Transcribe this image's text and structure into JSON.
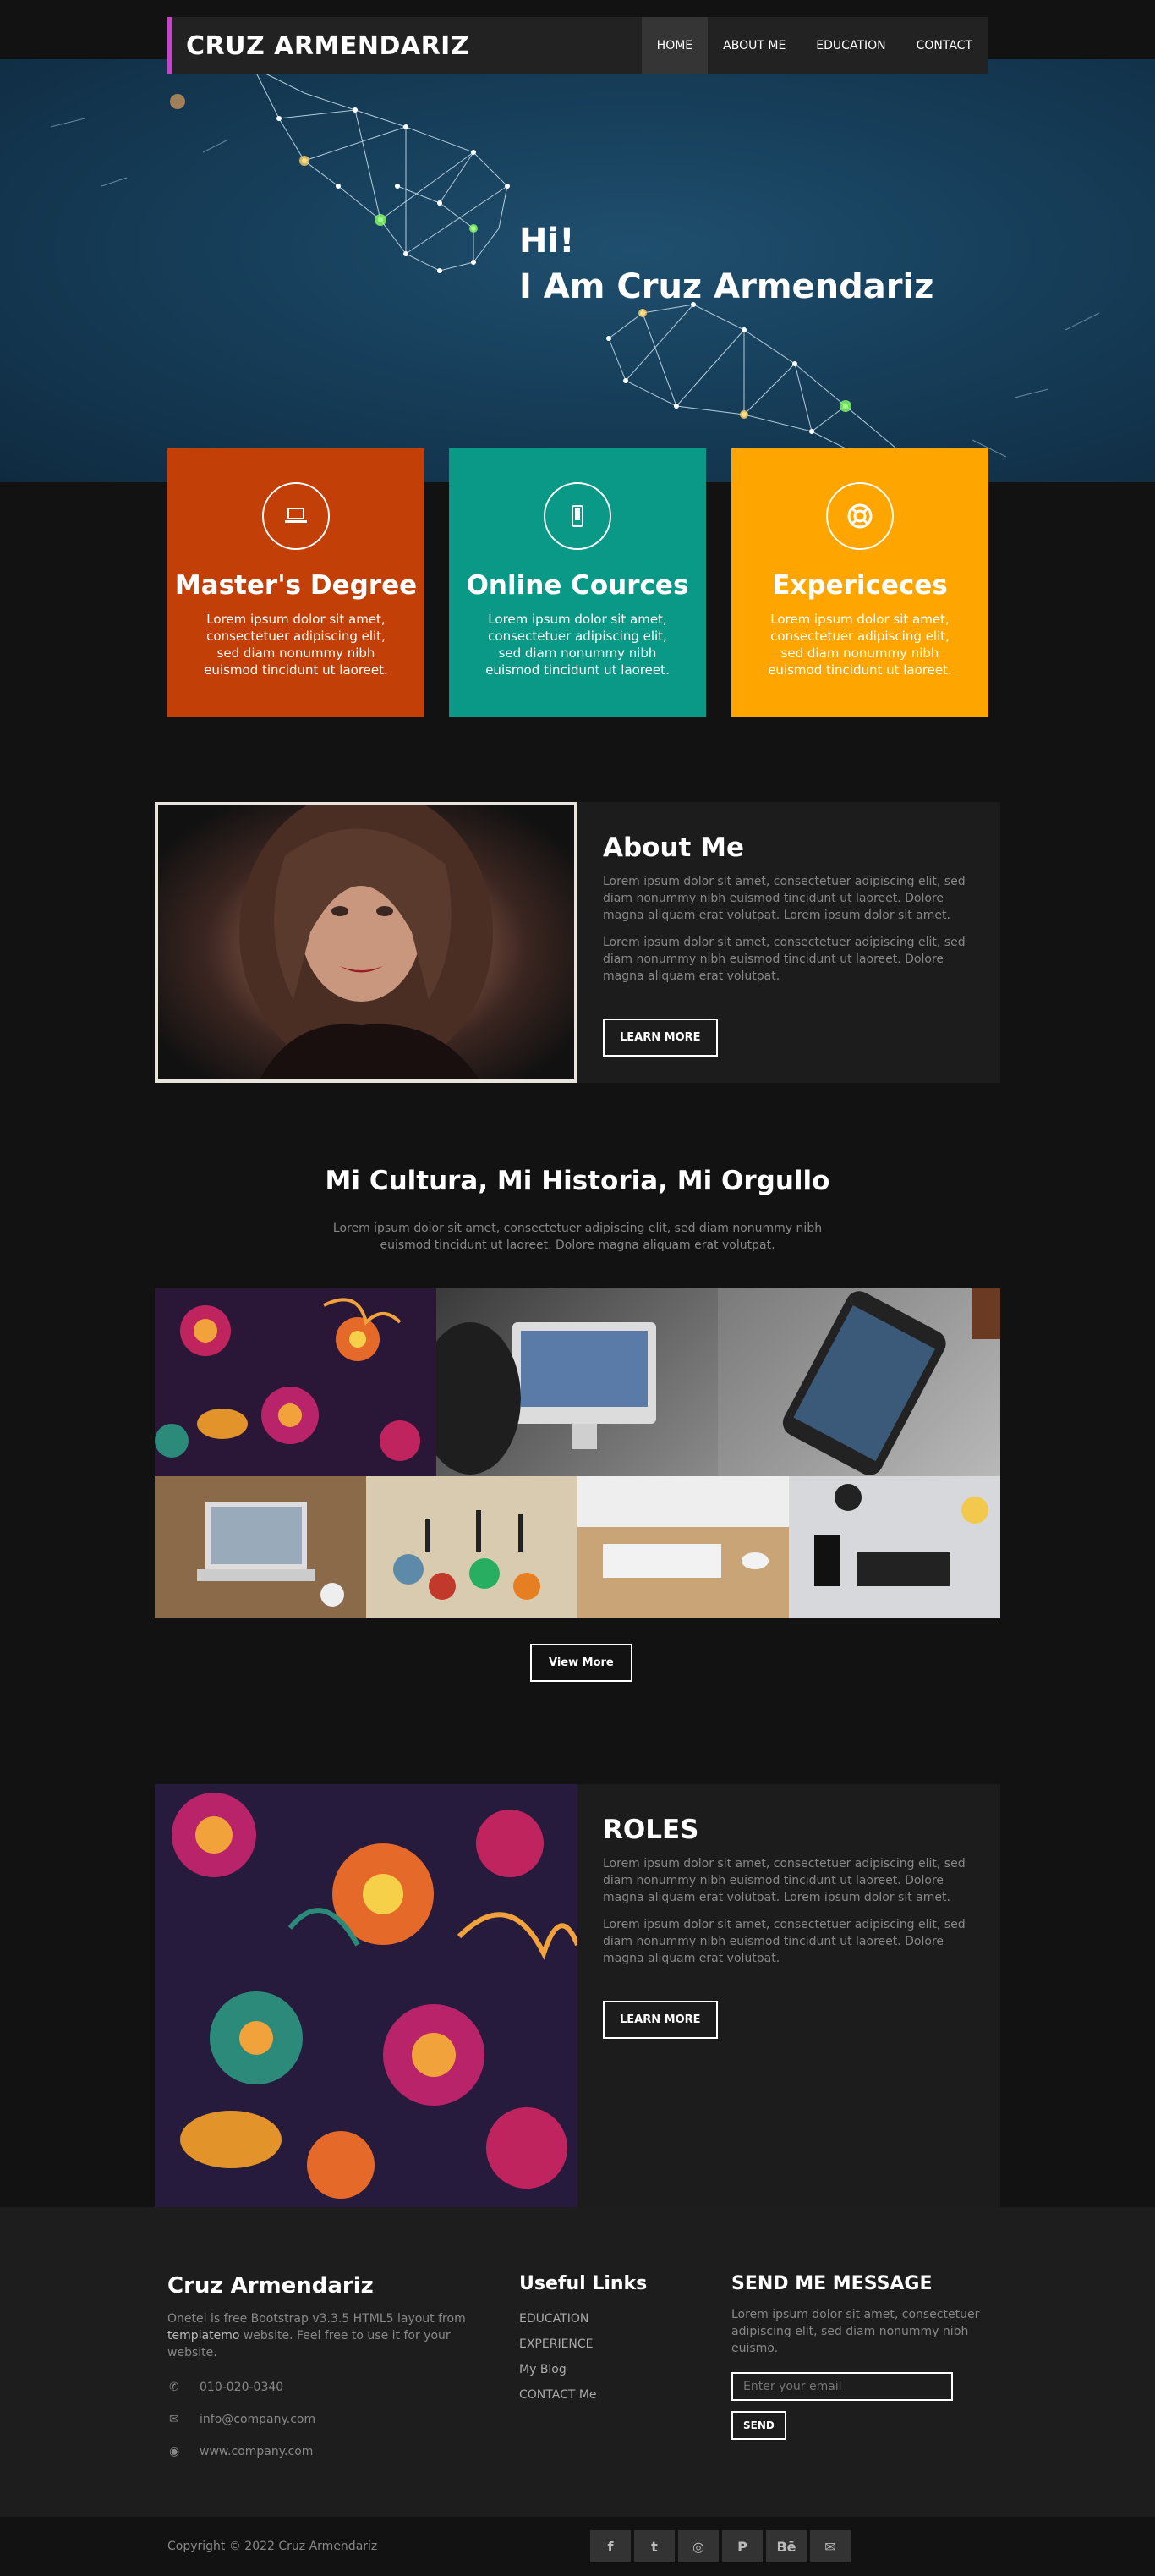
{
  "nav": {
    "brand": "CRUZ ARMENDARIZ",
    "accent": "#c146c8",
    "links": [
      "HOME",
      "ABOUT ME",
      "EDUCATION",
      "CONTACT"
    ],
    "active": "HOME"
  },
  "hero": {
    "line1": "Hi!",
    "line2": "I Am Cruz Armendariz"
  },
  "services": [
    {
      "title": "Master's Degree",
      "icon": "laptop-icon",
      "color": "#c23f08",
      "text": "Lorem ipsum dolor sit amet, consectetuer adipiscing elit, sed diam nonummy nibh euismod tincidunt ut laoreet."
    },
    {
      "title": "Online Cources",
      "icon": "mobile-icon",
      "color": "#0a9887",
      "text": "Lorem ipsum dolor sit amet, consectetuer adipiscing elit, sed diam nonummy nibh euismod tincidunt ut laoreet."
    },
    {
      "title": "Expericeces",
      "icon": "life-ring-icon",
      "color": "#ffa500",
      "text": "Lorem ipsum dolor sit amet, consectetuer adipiscing elit, sed diam nonummy nibh euismod tincidunt ut laoreet."
    }
  ],
  "about": {
    "title": "About Me",
    "p1": "Lorem ipsum dolor sit amet, consectetuer adipiscing elit, sed diam nonummy nibh euismod tincidunt ut laoreet. Dolore magna aliquam erat volutpat. Lorem ipsum dolor sit amet.",
    "p2": "Lorem ipsum dolor sit amet, consectetuer adipiscing elit, sed diam nonummy nibh euismod tincidunt ut laoreet. Dolore magna aliquam erat volutpat.",
    "button": "LEARN MORE"
  },
  "gallery": {
    "title": "Mi Cultura, Mi Historia, Mi Orgullo",
    "subtitle": "Lorem ipsum dolor sit amet, consectetuer adipiscing elit, sed diam nonummy nibh euismod tincidunt ut laoreet. Dolore magna aliquam erat volutpat.",
    "button": "View More"
  },
  "roles": {
    "title": "ROLES",
    "p1": "Lorem ipsum dolor sit amet, consectetuer adipiscing elit, sed diam nonummy nibh euismod tincidunt ut laoreet. Dolore magna aliquam erat volutpat. Lorem ipsum dolor sit amet.",
    "p2": "Lorem ipsum dolor sit amet, consectetuer adipiscing elit, sed diam nonummy nibh euismod tincidunt ut laoreet. Dolore magna aliquam erat volutpat.",
    "button": "LEARN MORE"
  },
  "footer": {
    "name": "Cruz Armendariz",
    "desc_before": "Onetel is free Bootstrap v3.3.5 HTML5 layout from ",
    "desc_link": "templatemo",
    "desc_after": " website. Feel free to use it for your website.",
    "phone": "010-020-0340",
    "email": "info@company.com",
    "website": "www.company.com",
    "links_title": "Useful Links",
    "links": [
      "EDUCATION",
      "EXPERIENCE",
      "My Blog",
      "CONTACT Me"
    ],
    "message_title": "SEND ME MESSAGE",
    "message_text": "Lorem ipsum dolor sit amet, consectetuer adipiscing elit, sed diam nonummy nibh euismo.",
    "email_placeholder": "Enter your email",
    "send": "SEND",
    "copyright": "Copyright © 2022 Cruz Armendariz",
    "socials": [
      "f",
      "t",
      "◎",
      "P",
      "Bē",
      "✉"
    ]
  }
}
